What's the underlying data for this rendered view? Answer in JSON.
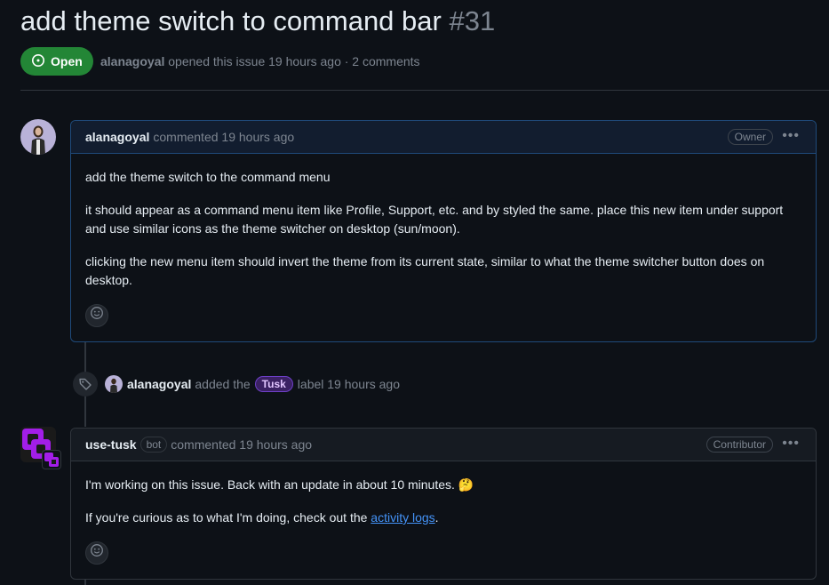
{
  "issue": {
    "title": "add theme switch to command bar",
    "number": "#31",
    "state": "Open",
    "author": "alanagoyal",
    "meta_rest": "opened this issue 19 hours ago · 2 comments"
  },
  "comments": [
    {
      "author": "alanagoyal",
      "action": "commented 19 hours ago",
      "role": "Owner",
      "paragraphs": [
        "add the theme switch to the command menu",
        "it should appear as a command menu item like Profile, Support, etc. and by styled the same. place this new item under support and use similar icons as the theme switcher on desktop (sun/moon).",
        "clicking the new menu item should invert the theme from its current state, similar to what the theme switcher button does on desktop."
      ]
    },
    {
      "author": "use-tusk",
      "bot_tag": "bot",
      "action": "commented 19 hours ago",
      "role": "Contributor",
      "paragraph1": "I'm working on this issue. Back with an update in about 10 minutes. 🤔",
      "paragraph2_pre": "If you're curious as to what I'm doing, check out the ",
      "paragraph2_link": "activity logs",
      "paragraph2_post": "."
    }
  ],
  "event": {
    "actor": "alanagoyal",
    "text_before": "added the",
    "label": "Tusk",
    "text_after": "label 19 hours ago"
  },
  "colors": {
    "open_green": "#238636",
    "link_blue": "#4493f8",
    "label_purple": "#6e40c9"
  }
}
